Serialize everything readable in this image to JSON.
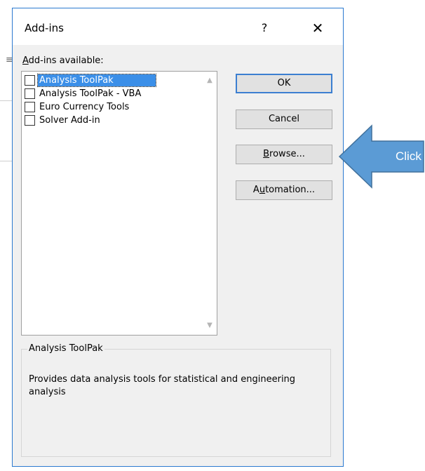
{
  "dialog": {
    "title": "Add-ins",
    "help_label": "?",
    "close_label": "✕",
    "list_label_prefix": "",
    "list_label_accel": "A",
    "list_label_rest": "dd-ins available:",
    "items": [
      {
        "label": "Analysis ToolPak",
        "checked": false,
        "selected": true
      },
      {
        "label": "Analysis ToolPak - VBA",
        "checked": false,
        "selected": false
      },
      {
        "label": "Euro Currency Tools",
        "checked": false,
        "selected": false
      },
      {
        "label": "Solver Add-in",
        "checked": false,
        "selected": false
      }
    ],
    "buttons": {
      "ok": "OK",
      "cancel": "Cancel",
      "browse_accel": "B",
      "browse_rest": "rowse...",
      "automation_pre": "A",
      "automation_accel": "u",
      "automation_rest": "tomation..."
    },
    "group": {
      "title": "Analysis ToolPak",
      "description": "Provides data analysis tools for statistical and engineering analysis"
    }
  },
  "annotation": {
    "label": "Click",
    "color": "#5b9bd5"
  }
}
